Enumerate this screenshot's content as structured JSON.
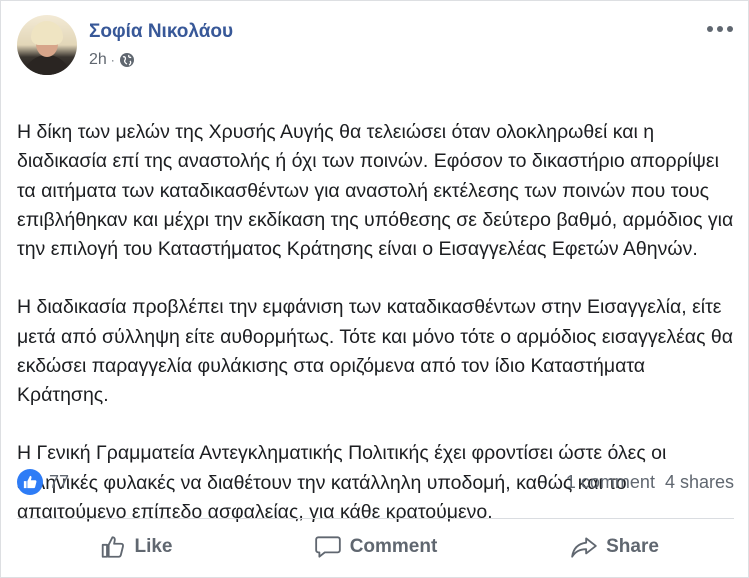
{
  "post": {
    "author": "Σοφία Νικολάου",
    "time": "2h",
    "separator": "·",
    "paragraphs": [
      "Η δίκη των μελών της Χρυσής Αυγής θα τελειώσει όταν ολοκληρωθεί και η διαδικασία επί της αναστολής ή όχι των ποινών. Εφόσον το δικαστήριο απορρίψει τα αιτήματα των καταδικασθέντων για αναστολή εκτέλεσης των ποινών που τους επιβλήθηκαν και μέχρι την εκδίκαση της υπόθεσης σε δεύτερο βαθμό, αρμόδιος για την επιλογή του Καταστήματος Κράτησης είναι ο Εισαγγελέας Εφετών Αθηνών.",
      "Η διαδικασία προβλέπει την εμφάνιση των καταδικασθέντων στην Εισαγγελία, είτε μετά από σύλληψη είτε αυθορμήτως. Τότε και μόνο τότε ο αρμόδιος εισαγγελέας θα εκδώσει παραγγελία φυλάκισης στα οριζόμενα από τον ίδιο Καταστήματα Κράτησης.",
      "Η Γενική Γραμματεία Αντεγκληματικής Πολιτικής έχει φροντίσει ώστε όλες οι ελληνικές φυλακές να διαθέτουν την κατάλληλη υποδομή, καθώς και το απαιτούμενο επίπεδο ασφαλείας, για κάθε κρατούμενο."
    ]
  },
  "stats": {
    "reactions": "77",
    "comments": "1 comment",
    "shares": "4 shares"
  },
  "actions": {
    "like": "Like",
    "comment": "Comment",
    "share": "Share"
  },
  "colors": {
    "accent": "#385898",
    "like_blue": "#2e7cf6",
    "muted": "#606770"
  },
  "icons": {
    "privacy": "globe-icon",
    "more": "more-options-icon",
    "reaction": "like-reaction-icon",
    "like": "thumbs-up-icon",
    "comment": "comment-bubble-icon",
    "share": "share-arrow-icon"
  }
}
